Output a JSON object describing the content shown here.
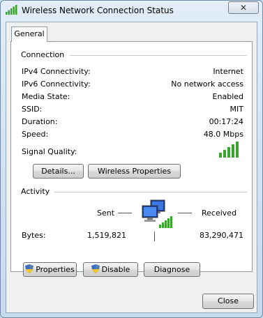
{
  "window": {
    "title": "Wireless Network Connection Status",
    "close_glyph": "✕"
  },
  "tabs": [
    {
      "label": "General"
    }
  ],
  "connection": {
    "group_label": "Connection",
    "rows": [
      {
        "label": "IPv4 Connectivity:",
        "value": "Internet"
      },
      {
        "label": "IPv6 Connectivity:",
        "value": "No network access"
      },
      {
        "label": "Media State:",
        "value": "Enabled"
      },
      {
        "label": "SSID:",
        "value": "MIT"
      },
      {
        "label": "Duration:",
        "value": "00:17:24"
      },
      {
        "label": "Speed:",
        "value": "48.0 Mbps"
      }
    ],
    "signal_label": "Signal Quality:",
    "signal_bars": 5,
    "signal_icon": "signal-strength-icon",
    "details_button": "Details...",
    "wireless_properties_button": "Wireless Properties"
  },
  "activity": {
    "group_label": "Activity",
    "sent_label": "Sent",
    "received_label": "Received",
    "bytes_label": "Bytes:",
    "bytes_sent": "1,519,821",
    "bytes_received": "83,290,471",
    "network_icon": "network-computers-icon"
  },
  "buttons": {
    "properties": "Properties",
    "disable": "Disable",
    "diagnose": "Diagnose",
    "close": "Close"
  },
  "colors": {
    "signal_green": "#3aa52d",
    "shield_blue": "#3b6fc4",
    "shield_yellow": "#f0c52a"
  }
}
